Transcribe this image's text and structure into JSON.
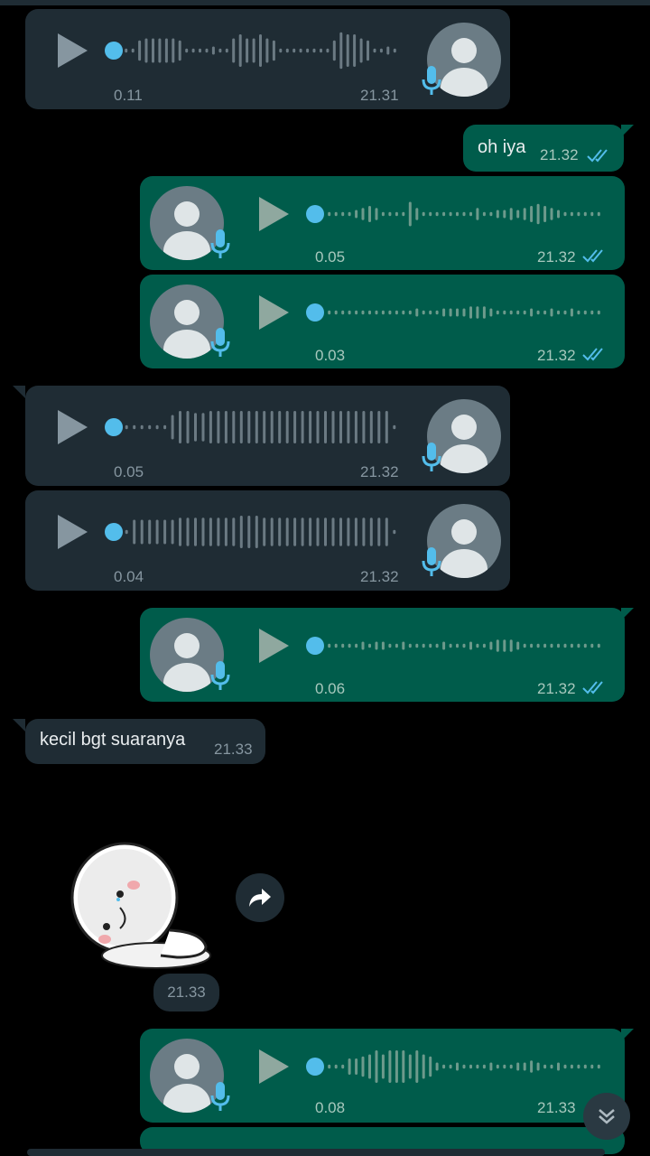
{
  "messages": [
    {
      "kind": "voice",
      "dir": "in",
      "duration": "0.11",
      "time": "21.31"
    },
    {
      "kind": "text",
      "dir": "out",
      "text": "oh iya",
      "time": "21.32"
    },
    {
      "kind": "voice",
      "dir": "out",
      "duration": "0.05",
      "time": "21.32"
    },
    {
      "kind": "voice",
      "dir": "out",
      "duration": "0.03",
      "time": "21.32"
    },
    {
      "kind": "voice",
      "dir": "in",
      "duration": "0.05",
      "time": "21.32"
    },
    {
      "kind": "voice",
      "dir": "in",
      "duration": "0.04",
      "time": "21.32"
    },
    {
      "kind": "voice",
      "dir": "out",
      "duration": "0.06",
      "time": "21.32"
    },
    {
      "kind": "text",
      "dir": "in",
      "text": "kecil bgt suaranya",
      "time": "21.33"
    },
    {
      "kind": "sticker",
      "dir": "in",
      "time": "21.33"
    },
    {
      "kind": "voice",
      "dir": "out",
      "duration": "0.08",
      "time": "21.33"
    }
  ],
  "colors": {
    "incoming": "#1f2c34",
    "outgoing": "#005c4b",
    "accent": "#53bdeb",
    "background": "#000000"
  },
  "icons": [
    "play-icon",
    "mic-icon",
    "double-check-icon",
    "forward-icon",
    "scroll-down-icon",
    "avatar-icon"
  ]
}
